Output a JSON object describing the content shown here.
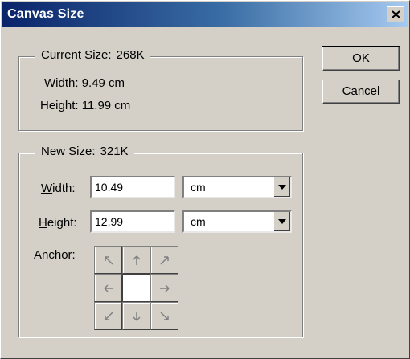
{
  "window": {
    "title": "Canvas Size",
    "close_label": "×"
  },
  "current_size": {
    "label": "Current Size:",
    "value": "268K",
    "width_label": "Width:",
    "width_value": "9.49 cm",
    "height_label": "Height:",
    "height_value": "11.99 cm"
  },
  "new_size": {
    "label": "New Size:",
    "value": "321K",
    "width_label_mnemonic": "W",
    "width_label_rest": "idth:",
    "width_value": "10.49",
    "width_unit": "cm",
    "height_label_mnemonic": "H",
    "height_label_rest": "eight:",
    "height_value": "12.99",
    "height_unit": "cm",
    "anchor_label": "Anchor:",
    "anchor_selected": "center"
  },
  "buttons": {
    "ok": "OK",
    "cancel": "Cancel"
  },
  "colors": {
    "title_start": "#0a246a",
    "title_end": "#a6caf0",
    "face": "#d4d0c8"
  }
}
